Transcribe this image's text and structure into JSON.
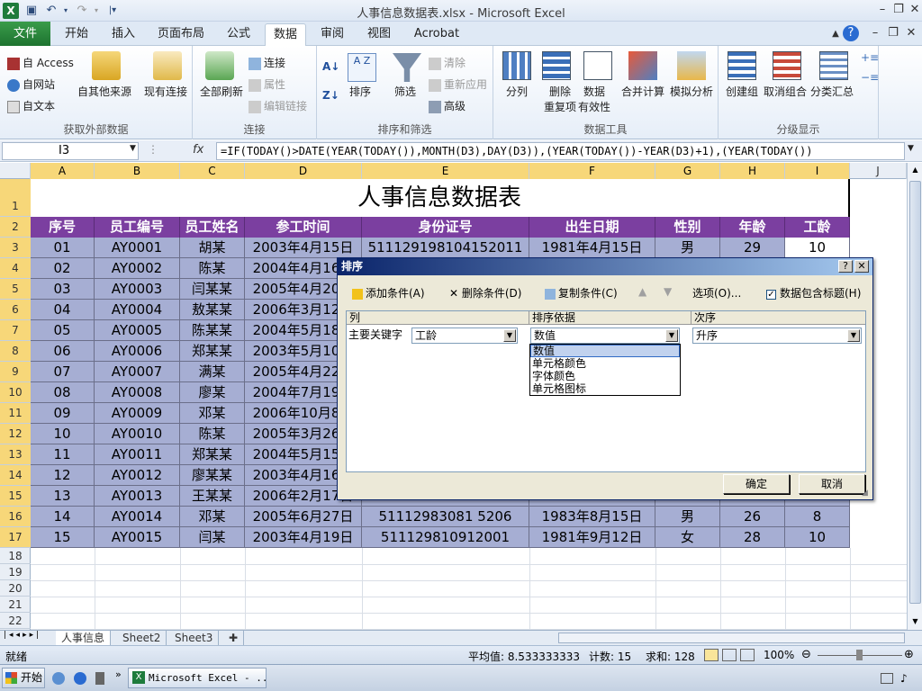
{
  "window": {
    "title": "人事信息数据表.xlsx - Microsoft Excel"
  },
  "ribbon": {
    "file_tab": "文件",
    "tabs": [
      "开始",
      "插入",
      "页面布局",
      "公式",
      "数据",
      "审阅",
      "视图",
      "Acrobat"
    ],
    "active_tab": "数据",
    "groups": {
      "external": {
        "label": "获取外部数据",
        "access": "自 Access",
        "web": "自网站",
        "text": "自文本",
        "other": "自其他来源",
        "existing": "现有连接"
      },
      "connections": {
        "label": "连接",
        "refresh_all": "全部刷新",
        "connections": "连接",
        "properties": "属性",
        "edit_links": "编辑链接"
      },
      "sort_filter": {
        "label": "排序和筛选",
        "sort": "排序",
        "filter": "筛选",
        "clear": "清除",
        "reapply": "重新应用",
        "advanced": "高级"
      },
      "data_tools": {
        "label": "数据工具",
        "split": "分列",
        "remove_dup_1": "删除",
        "remove_dup_2": "重复项",
        "validation_1": "数据",
        "validation_2": "有效性",
        "consolidate": "合并计算",
        "whatif": "模拟分析"
      },
      "outline": {
        "label": "分级显示",
        "group": "创建组",
        "ungroup": "取消组合",
        "subtotal": "分类汇总"
      }
    }
  },
  "formula_bar": {
    "name_box": "I3",
    "fx": "fx",
    "formula": "=IF(TODAY()>DATE(YEAR(TODAY()),MONTH(D3),DAY(D3)),(YEAR(TODAY())-YEAR(D3)+1),(YEAR(TODAY())"
  },
  "sheet": {
    "columns": [
      "A",
      "B",
      "C",
      "D",
      "E",
      "F",
      "G",
      "H",
      "I",
      "J"
    ],
    "rows": [
      "1",
      "2",
      "3",
      "4",
      "5",
      "6",
      "7",
      "8",
      "9",
      "10",
      "11",
      "12",
      "13",
      "14",
      "15",
      "16",
      "17",
      "18",
      "19",
      "20",
      "21",
      "22"
    ],
    "title": "人事信息数据表",
    "headers": [
      "序号",
      "员工编号",
      "员工姓名",
      "参工时间",
      "身份证号",
      "出生日期",
      "性别",
      "年龄",
      "工龄"
    ],
    "data": [
      [
        "01",
        "AY0001",
        "胡某",
        "2003年4月15日",
        "511129198104152011",
        "1981年4月15日",
        "男",
        "29",
        "10"
      ],
      [
        "02",
        "AY0002",
        "陈某",
        "2004年4月16日",
        "",
        "",
        "",
        "",
        ""
      ],
      [
        "03",
        "AY0003",
        "闫某某",
        "2005年4月20日",
        "",
        "",
        "",
        "",
        ""
      ],
      [
        "04",
        "AY0004",
        "敖某某",
        "2006年3月12日",
        "",
        "",
        "",
        "",
        ""
      ],
      [
        "05",
        "AY0005",
        "陈某某",
        "2004年5月18日",
        "",
        "",
        "",
        "",
        ""
      ],
      [
        "06",
        "AY0006",
        "郑某某",
        "2003年5月10日",
        "",
        "",
        "",
        "",
        ""
      ],
      [
        "07",
        "AY0007",
        "满某",
        "2005年4月22日",
        "",
        "",
        "",
        "",
        ""
      ],
      [
        "08",
        "AY0008",
        "廖某",
        "2004年7月19日",
        "",
        "",
        "",
        "",
        ""
      ],
      [
        "09",
        "AY0009",
        "邓某",
        "2006年10月8日",
        "",
        "",
        "",
        "",
        ""
      ],
      [
        "10",
        "AY0010",
        "陈某",
        "2005年3月26日",
        "",
        "",
        "",
        "",
        ""
      ],
      [
        "11",
        "AY0011",
        "郑某某",
        "2004年5月15日",
        "",
        "",
        "",
        "",
        ""
      ],
      [
        "12",
        "AY0012",
        "廖某某",
        "2003年4月16日",
        "",
        "",
        "",
        "",
        ""
      ],
      [
        "13",
        "AY0013",
        "王某某",
        "2006年2月17日",
        "",
        "",
        "",
        "",
        ""
      ],
      [
        "14",
        "AY0014",
        "邓某",
        "2005年6月27日",
        "51112983081 5206",
        "1983年8月15日",
        "男",
        "26",
        "8"
      ],
      [
        "15",
        "AY0015",
        "闫某",
        "2003年4月19日",
        "511129810912001",
        "1981年9月12日",
        "女",
        "28",
        "10"
      ]
    ],
    "tabs": [
      "人事信息",
      "Sheet2",
      "Sheet3"
    ]
  },
  "status": {
    "ready": "就绪",
    "average": "平均值: 8.533333333",
    "count": "计数: 15",
    "sum": "求和: 128",
    "zoom": "100%"
  },
  "taskbar": {
    "start": "开始",
    "excel": "Microsoft Excel - ..."
  },
  "dialog": {
    "title": "排序",
    "add_condition": "添加条件(A)",
    "delete_condition": "删除条件(D)",
    "copy_condition": "复制条件(C)",
    "options": "选项(O)...",
    "has_headers": "数据包含标题(H)",
    "col_header": "列",
    "sorton_header": "排序依据",
    "order_header": "次序",
    "primary_key": "主要关键字",
    "column_value": "工龄",
    "sorton_value": "数值",
    "order_value": "升序",
    "dropdown_options": [
      "数值",
      "单元格颜色",
      "字体颜色",
      "单元格图标"
    ],
    "ok": "确定",
    "cancel": "取消"
  }
}
